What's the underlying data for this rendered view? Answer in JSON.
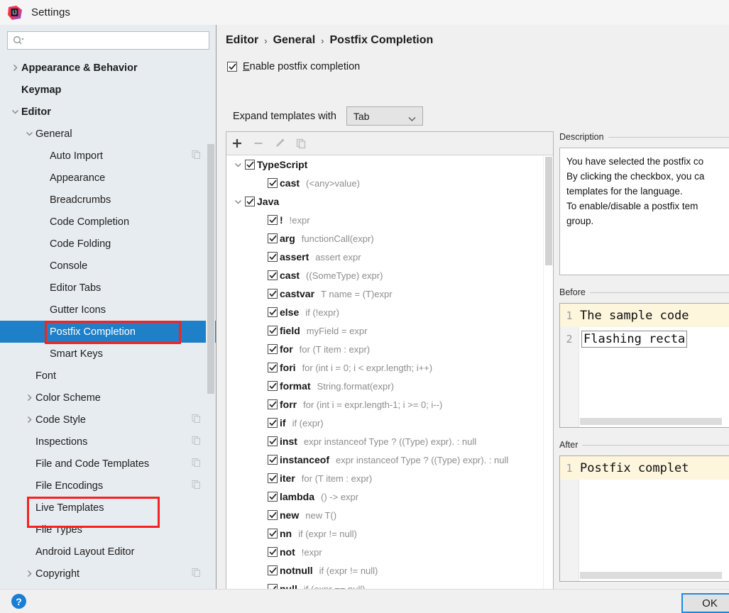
{
  "window": {
    "title": "Settings",
    "logo_icon": "intellij-idea-logo"
  },
  "sidebar": {
    "search": {
      "value": "",
      "placeholder": "",
      "icon": "search-icon"
    },
    "items": [
      {
        "label": "Appearance & Behavior",
        "indent": 0,
        "arrow": "collapsed",
        "bold": true,
        "selected": false,
        "badge": false
      },
      {
        "label": "Keymap",
        "indent": 0,
        "arrow": "none",
        "bold": true,
        "selected": false,
        "badge": false
      },
      {
        "label": "Editor",
        "indent": 0,
        "arrow": "expanded",
        "bold": true,
        "selected": false,
        "badge": false
      },
      {
        "label": "General",
        "indent": 1,
        "arrow": "expanded",
        "bold": false,
        "selected": false,
        "badge": false
      },
      {
        "label": "Auto Import",
        "indent": 2,
        "arrow": "none",
        "bold": false,
        "selected": false,
        "badge": true
      },
      {
        "label": "Appearance",
        "indent": 2,
        "arrow": "none",
        "bold": false,
        "selected": false,
        "badge": false
      },
      {
        "label": "Breadcrumbs",
        "indent": 2,
        "arrow": "none",
        "bold": false,
        "selected": false,
        "badge": false
      },
      {
        "label": "Code Completion",
        "indent": 2,
        "arrow": "none",
        "bold": false,
        "selected": false,
        "badge": false
      },
      {
        "label": "Code Folding",
        "indent": 2,
        "arrow": "none",
        "bold": false,
        "selected": false,
        "badge": false
      },
      {
        "label": "Console",
        "indent": 2,
        "arrow": "none",
        "bold": false,
        "selected": false,
        "badge": false
      },
      {
        "label": "Editor Tabs",
        "indent": 2,
        "arrow": "none",
        "bold": false,
        "selected": false,
        "badge": false
      },
      {
        "label": "Gutter Icons",
        "indent": 2,
        "arrow": "none",
        "bold": false,
        "selected": false,
        "badge": false
      },
      {
        "label": "Postfix Completion",
        "indent": 2,
        "arrow": "none",
        "bold": false,
        "selected": true,
        "badge": false
      },
      {
        "label": "Smart Keys",
        "indent": 2,
        "arrow": "none",
        "bold": false,
        "selected": false,
        "badge": false
      },
      {
        "label": "Font",
        "indent": 1,
        "arrow": "none",
        "bold": false,
        "selected": false,
        "badge": false
      },
      {
        "label": "Color Scheme",
        "indent": 1,
        "arrow": "collapsed",
        "bold": false,
        "selected": false,
        "badge": false
      },
      {
        "label": "Code Style",
        "indent": 1,
        "arrow": "collapsed",
        "bold": false,
        "selected": false,
        "badge": true
      },
      {
        "label": "Inspections",
        "indent": 1,
        "arrow": "none",
        "bold": false,
        "selected": false,
        "badge": true
      },
      {
        "label": "File and Code Templates",
        "indent": 1,
        "arrow": "none",
        "bold": false,
        "selected": false,
        "badge": true
      },
      {
        "label": "File Encodings",
        "indent": 1,
        "arrow": "none",
        "bold": false,
        "selected": false,
        "badge": true
      },
      {
        "label": "Live Templates",
        "indent": 1,
        "arrow": "none",
        "bold": false,
        "selected": false,
        "badge": false
      },
      {
        "label": "File Types",
        "indent": 1,
        "arrow": "none",
        "bold": false,
        "selected": false,
        "badge": false
      },
      {
        "label": "Android Layout Editor",
        "indent": 1,
        "arrow": "none",
        "bold": false,
        "selected": false,
        "badge": false
      },
      {
        "label": "Copyright",
        "indent": 1,
        "arrow": "collapsed",
        "bold": false,
        "selected": false,
        "badge": true
      }
    ]
  },
  "main": {
    "breadcrumb": [
      "Editor",
      "General",
      "Postfix Completion"
    ],
    "separator": "›",
    "enable_checkbox": {
      "label": "Enable postfix completion",
      "checked": true,
      "mnemonic": "E"
    },
    "expand_row": {
      "label": "Expand templates with",
      "value": "Tab"
    },
    "toolbar": [
      {
        "name": "add-button",
        "glyph": "+",
        "enabled": true
      },
      {
        "name": "remove-button",
        "glyph": "−",
        "enabled": false
      },
      {
        "name": "edit-button",
        "glyph": "pencil",
        "enabled": false
      },
      {
        "name": "copy-button",
        "glyph": "copy",
        "enabled": false
      }
    ],
    "templates": [
      {
        "type": "group",
        "key": "TypeScript",
        "desc": "",
        "checked": true,
        "expanded": true
      },
      {
        "type": "item",
        "key": "cast",
        "desc": "(<any>value)",
        "checked": true
      },
      {
        "type": "group",
        "key": "Java",
        "desc": "",
        "checked": true,
        "expanded": true
      },
      {
        "type": "item",
        "key": "!",
        "desc": "!expr",
        "checked": true
      },
      {
        "type": "item",
        "key": "arg",
        "desc": "functionCall(expr)",
        "checked": true
      },
      {
        "type": "item",
        "key": "assert",
        "desc": "assert expr",
        "checked": true
      },
      {
        "type": "item",
        "key": "cast",
        "desc": "((SomeType) expr)",
        "checked": true
      },
      {
        "type": "item",
        "key": "castvar",
        "desc": "T name = (T)expr",
        "checked": true
      },
      {
        "type": "item",
        "key": "else",
        "desc": "if (!expr)",
        "checked": true
      },
      {
        "type": "item",
        "key": "field",
        "desc": "myField = expr",
        "checked": true
      },
      {
        "type": "item",
        "key": "for",
        "desc": "for (T item : expr)",
        "checked": true
      },
      {
        "type": "item",
        "key": "fori",
        "desc": "for (int i = 0; i < expr.length; i++)",
        "checked": true
      },
      {
        "type": "item",
        "key": "format",
        "desc": "String.format(expr)",
        "checked": true
      },
      {
        "type": "item",
        "key": "forr",
        "desc": "for (int i = expr.length-1; i >= 0; i--)",
        "checked": true
      },
      {
        "type": "item",
        "key": "if",
        "desc": "if (expr)",
        "checked": true
      },
      {
        "type": "item",
        "key": "inst",
        "desc": "expr instanceof Type ? ((Type) expr). : null",
        "checked": true
      },
      {
        "type": "item",
        "key": "instanceof",
        "desc": "expr instanceof Type ? ((Type) expr). : null",
        "checked": true
      },
      {
        "type": "item",
        "key": "iter",
        "desc": "for (T item : expr)",
        "checked": true
      },
      {
        "type": "item",
        "key": "lambda",
        "desc": "() -> expr",
        "checked": true
      },
      {
        "type": "item",
        "key": "new",
        "desc": "new T()",
        "checked": true
      },
      {
        "type": "item",
        "key": "nn",
        "desc": "if (expr != null)",
        "checked": true
      },
      {
        "type": "item",
        "key": "not",
        "desc": "!expr",
        "checked": true
      },
      {
        "type": "item",
        "key": "notnull",
        "desc": "if (expr != null)",
        "checked": true
      },
      {
        "type": "item",
        "key": "null",
        "desc": "if (expr == null)",
        "checked": true
      }
    ]
  },
  "right": {
    "description_label": "Description",
    "description_lines": [
      "You have selected the postfix co",
      "By clicking the checkbox, you ca",
      "templates for the language.",
      "To enable/disable a postfix tem",
      "group."
    ],
    "before_label": "Before",
    "before_lines": [
      {
        "num": "1",
        "text": "The sample code",
        "highlight": true,
        "boxed": false
      },
      {
        "num": "2",
        "text": "Flashing recta",
        "highlight": false,
        "boxed": true
      }
    ],
    "after_label": "After",
    "after_lines": [
      {
        "num": "1",
        "text": "Postfix complet",
        "highlight": true,
        "boxed": false
      }
    ]
  },
  "bottom": {
    "help_label": "?",
    "ok_label": "OK"
  },
  "colors": {
    "selection": "#1f7fc7",
    "annotation": "#f5231f",
    "sidebar_bg": "#e7ecf0",
    "code_highlight": "#fdf6dd",
    "help_blue": "#1a7fd4"
  }
}
